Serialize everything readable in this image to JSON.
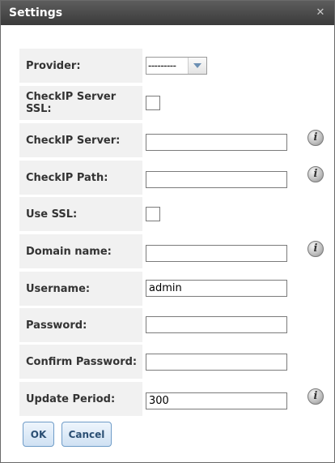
{
  "dialog": {
    "title": "Settings",
    "close_icon": "close-icon"
  },
  "form": {
    "provider": {
      "label": "Provider:",
      "value": "---------"
    },
    "checkip_server_ssl": {
      "label": "CheckIP Server SSL:",
      "checked": false
    },
    "checkip_server": {
      "label": "CheckIP Server:",
      "value": ""
    },
    "checkip_path": {
      "label": "CheckIP Path:",
      "value": ""
    },
    "use_ssl": {
      "label": "Use SSL:",
      "checked": false
    },
    "domain_name": {
      "label": "Domain name:",
      "value": ""
    },
    "username": {
      "label": "Username:",
      "value": "admin"
    },
    "password": {
      "label": "Password:",
      "value": ""
    },
    "confirm_password": {
      "label": "Confirm Password:",
      "value": ""
    },
    "update_period": {
      "label": "Update Period:",
      "value": "300"
    }
  },
  "buttons": {
    "ok": "OK",
    "cancel": "Cancel"
  },
  "icons": {
    "info": "i"
  }
}
